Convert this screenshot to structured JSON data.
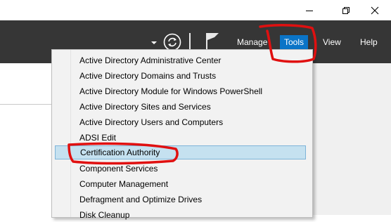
{
  "window_controls": {
    "minimize_icon": "minimize-icon",
    "maximize_icon": "restore-icon",
    "close_icon": "close-icon"
  },
  "toolbar": {
    "refresh_icon": "refresh-icon",
    "flag_icon": "notifications-flag-icon",
    "menu": [
      {
        "label": "Manage"
      },
      {
        "label": "Tools"
      },
      {
        "label": "View"
      },
      {
        "label": "Help"
      }
    ]
  },
  "tools_menu": {
    "items": [
      {
        "label": "Active Directory Administrative Center"
      },
      {
        "label": "Active Directory Domains and Trusts"
      },
      {
        "label": "Active Directory Module for Windows PowerShell"
      },
      {
        "label": "Active Directory Sites and Services"
      },
      {
        "label": "Active Directory Users and Computers"
      },
      {
        "label": "ADSI Edit"
      },
      {
        "label": "Certification Authority"
      },
      {
        "label": "Component Services"
      },
      {
        "label": "Computer Management"
      },
      {
        "label": "Defragment and Optimize Drives"
      },
      {
        "label": "Disk Cleanup"
      }
    ],
    "highlighted": "Certification Authority"
  },
  "colors": {
    "toolbar_bg": "#363636",
    "tools_active_bg": "#0a74c7",
    "highlight_bg": "#c5e1f0",
    "annotation_red": "#e01010"
  }
}
